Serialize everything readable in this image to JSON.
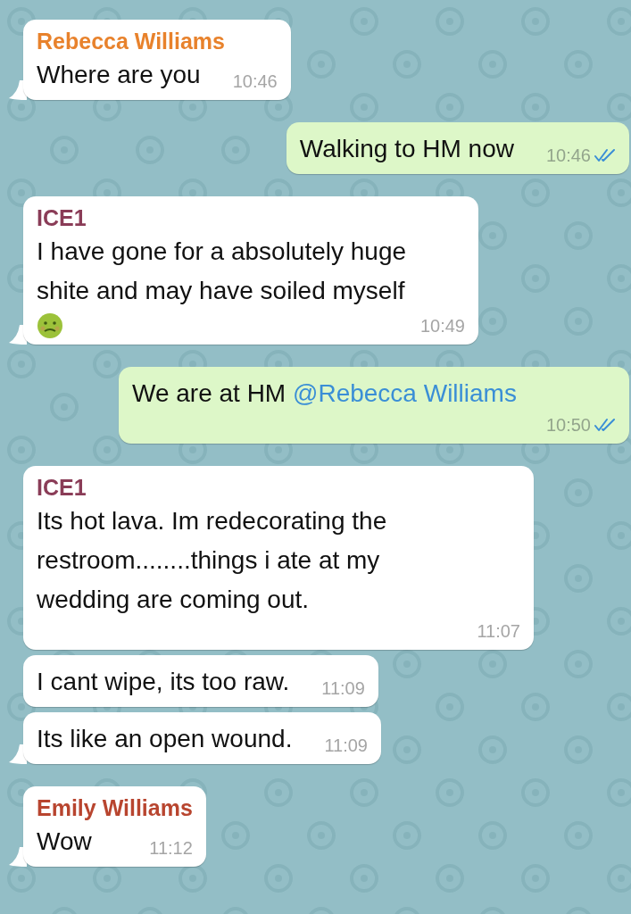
{
  "messages": [
    {
      "outgoing": false,
      "sender": "Rebecca Williams",
      "color": "#e8822c",
      "text": "Where are you",
      "time": "10:46",
      "tail": true
    },
    {
      "outgoing": true,
      "text": "Walking to HM now",
      "time": "10:46",
      "read": true
    },
    {
      "outgoing": false,
      "sender": "ICE1",
      "color": "#8a3c57",
      "text": "I have gone for a absolutely huge shite and may have soiled myself",
      "has_emoji": true,
      "time": "10:49",
      "tail": true
    },
    {
      "outgoing": true,
      "text": "We are at HM",
      "mention": "@Rebecca Williams",
      "time": "10:50",
      "read": true
    },
    {
      "outgoing": false,
      "sender": "ICE1",
      "color": "#8a3c57",
      "text": "Its hot lava. Im redecorating the restroom........things i ate at my wedding are coming out.",
      "time": "11:07",
      "tail": false
    },
    {
      "outgoing": false,
      "text": "I cant wipe, its too raw.",
      "time": "11:09",
      "tail": false
    },
    {
      "outgoing": false,
      "text": "Its like an open wound.",
      "time": "11:09",
      "tail": true
    },
    {
      "outgoing": false,
      "sender": "Emily Williams",
      "color": "#b8452f",
      "text": "Wow",
      "time": "11:12",
      "tail": true
    }
  ]
}
